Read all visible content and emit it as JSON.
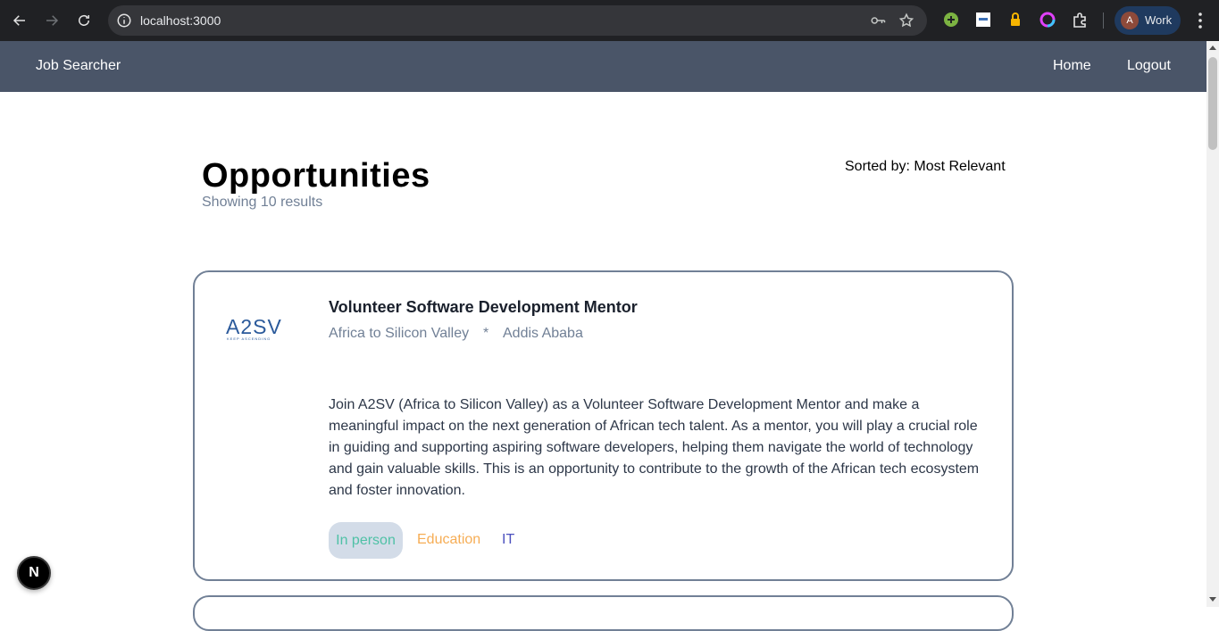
{
  "browser": {
    "url": "localhost:3000",
    "profile_initial": "A",
    "profile_label": "Work"
  },
  "header": {
    "brand": "Job Searcher",
    "nav": [
      "Home",
      "Logout"
    ],
    "bg_color": "#4a5568"
  },
  "page": {
    "title": "Opportunities",
    "result_count": "Showing 10 results",
    "sort_label": "Sorted by: Most Relevant"
  },
  "jobs": [
    {
      "logo_text": "A2SV",
      "logo_tagline": "KEEP ASCENDING",
      "title": "Volunteer Software Development Mentor",
      "company": "Africa to Silicon Valley",
      "separator": "*",
      "location": "Addis Ababa",
      "description": "Join A2SV (Africa to Silicon Valley) as a Volunteer Software Development Mentor and make a meaningful impact on the next generation of African tech talent. As a mentor, you will play a crucial role in guiding and supporting aspiring software developers, helping them navigate the world of technology and gain valuable skills. This is an opportunity to contribute to the growth of the African tech ecosystem and foster innovation.",
      "tags": [
        "In person",
        "Education",
        "IT"
      ]
    }
  ],
  "dev_badge": "N"
}
